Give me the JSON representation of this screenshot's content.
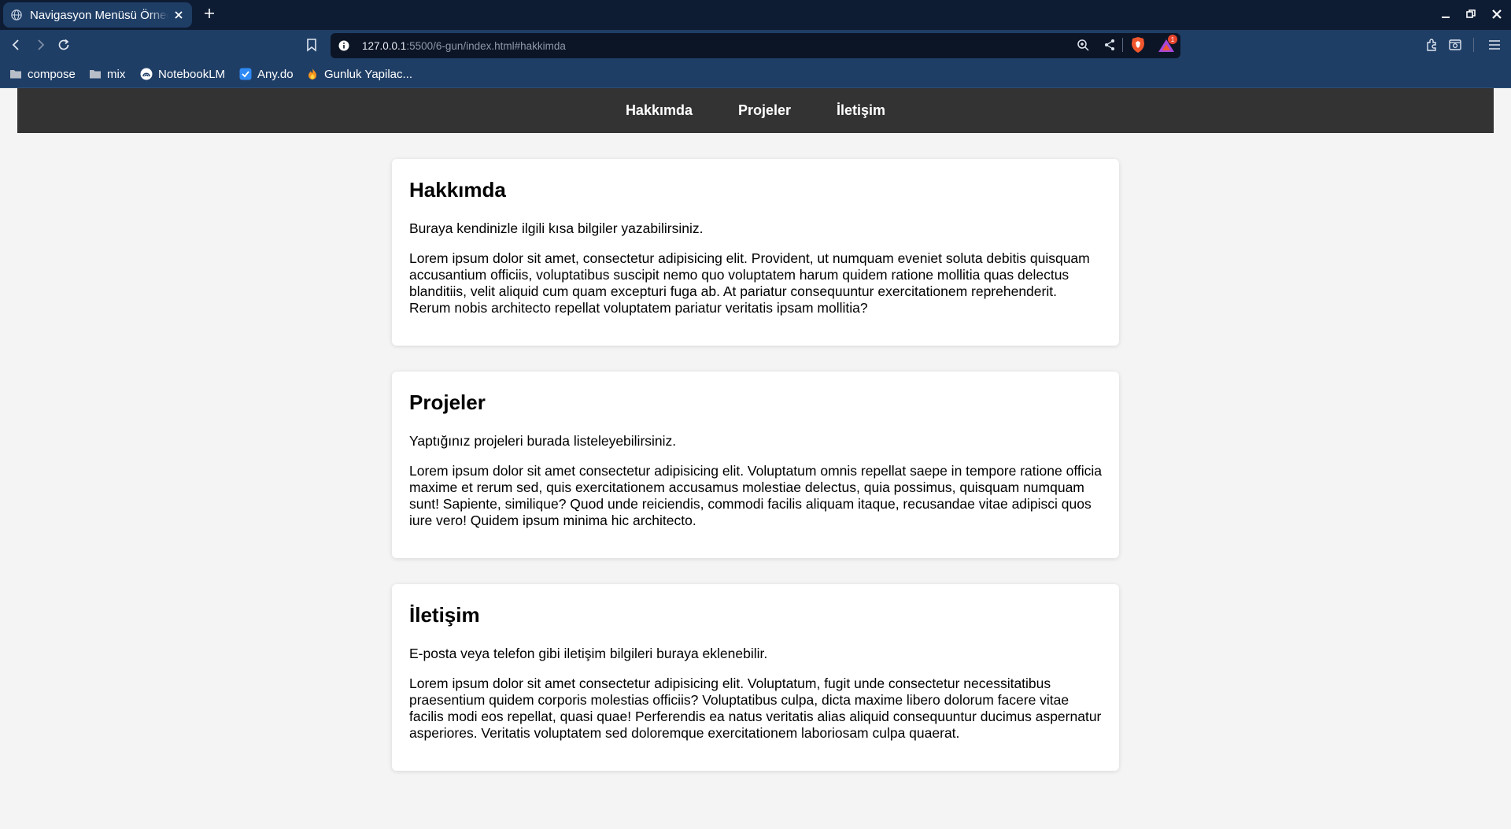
{
  "browser": {
    "tab": {
      "title": "Navigasyon Menüsü Örneği"
    },
    "url": {
      "host": "127.0.0.1",
      "path": ":5500/6-gun/index.html#hakkimda"
    },
    "rewards_badge": "1",
    "bookmarks": [
      {
        "label": "compose",
        "icon": "folder-icon"
      },
      {
        "label": "mix",
        "icon": "folder-icon"
      },
      {
        "label": "NotebookLM",
        "icon": "notebooklm-icon"
      },
      {
        "label": "Any.do",
        "icon": "anydo-icon"
      },
      {
        "label": "Gunluk Yapilac...",
        "icon": "fire-icon"
      }
    ],
    "colors": {
      "tabbar": "#0e1c33",
      "toolbar": "#1f3e66",
      "urlbar": "#0c1526"
    }
  },
  "page": {
    "nav": [
      {
        "label": "Hakkımda"
      },
      {
        "label": "Projeler"
      },
      {
        "label": "İletişim"
      }
    ],
    "sections": [
      {
        "title": "Hakkımda",
        "intro": "Buraya kendinizle ilgili kısa bilgiler yazabilirsiniz.",
        "body": "Lorem ipsum dolor sit amet, consectetur adipisicing elit. Provident, ut numquam eveniet soluta debitis quisquam accusantium officiis, voluptatibus suscipit nemo quo voluptatem harum quidem ratione mollitia quas delectus blanditiis, velit aliquid cum quam excepturi fuga ab. At pariatur consequuntur exercitationem reprehenderit. Rerum nobis architecto repellat voluptatem pariatur veritatis ipsam mollitia?"
      },
      {
        "title": "Projeler",
        "intro": "Yaptığınız projeleri burada listeleyebilirsiniz.",
        "body": "Lorem ipsum dolor sit amet consectetur adipisicing elit. Voluptatum omnis repellat saepe in tempore ratione officia maxime et rerum sed, quis exercitationem accusamus molestiae delectus, quia possimus, quisquam numquam sunt! Sapiente, similique? Quod unde reiciendis, commodi facilis aliquam itaque, recusandae vitae adipisci quos iure vero! Quidem ipsum minima hic architecto."
      },
      {
        "title": "İletişim",
        "intro": "E-posta veya telefon gibi iletişim bilgileri buraya eklenebilir.",
        "body": "Lorem ipsum dolor sit amet consectetur adipisicing elit. Voluptatum, fugit unde consectetur necessitatibus praesentium quidem corporis molestias officiis? Voluptatibus culpa, dicta maxime libero dolorum facere vitae facilis modi eos repellat, quasi quae! Perferendis ea natus veritatis alias aliquid consequuntur ducimus aspernatur asperiores. Veritatis voluptatem sed doloremque exercitationem laboriosam culpa quaerat."
      }
    ],
    "colors": {
      "nav_bg": "#333333",
      "page_bg": "#f4f4f4",
      "card_bg": "#ffffff"
    }
  }
}
